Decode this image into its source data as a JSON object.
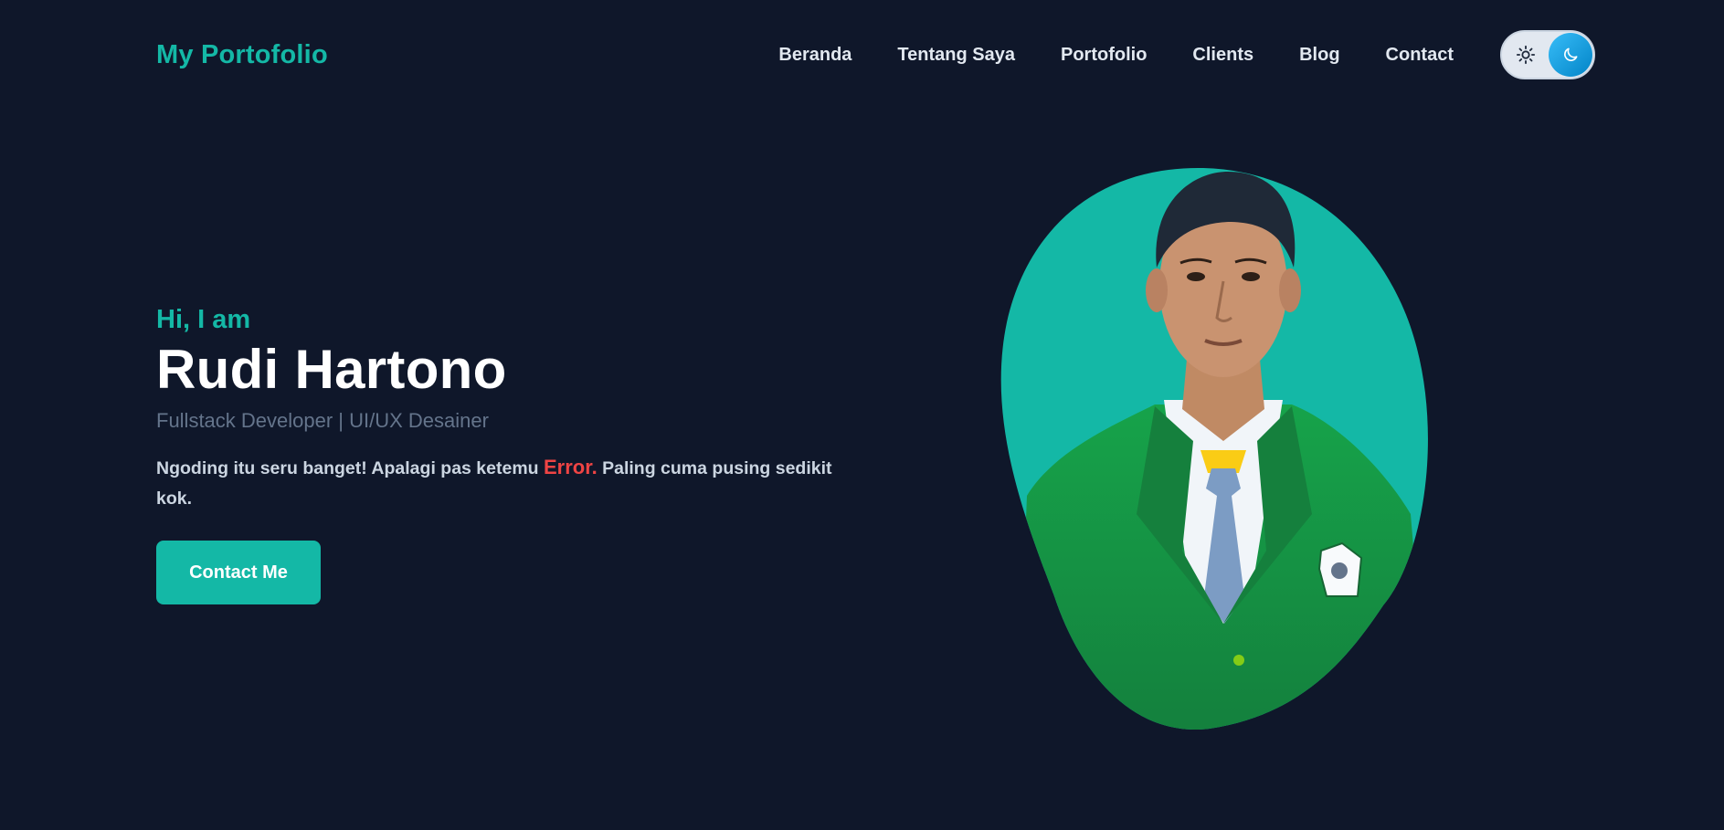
{
  "header": {
    "logo": "My Portofolio",
    "nav": [
      {
        "label": "Beranda"
      },
      {
        "label": "Tentang Saya"
      },
      {
        "label": "Portofolio"
      },
      {
        "label": "Clients"
      },
      {
        "label": "Blog"
      },
      {
        "label": "Contact"
      }
    ],
    "theme_toggle": {
      "left_icon": "sun-icon",
      "right_icon": "moon-icon",
      "mode": "dark"
    }
  },
  "hero": {
    "greeting": "Hi, I am",
    "name": "Rudi Hartono",
    "role": "Fullstack Developer | UI/UX Desainer",
    "desc_before": "Ngoding itu seru banget! Apalagi pas ketemu ",
    "desc_highlight": "Error.",
    "desc_after": " Paling cuma pusing sedikit kok.",
    "cta": "Contact Me"
  },
  "colors": {
    "background": "#0f172a",
    "accent": "#14b8a6",
    "error": "#ef4444",
    "toggle_knob": "#0ea5e9"
  }
}
